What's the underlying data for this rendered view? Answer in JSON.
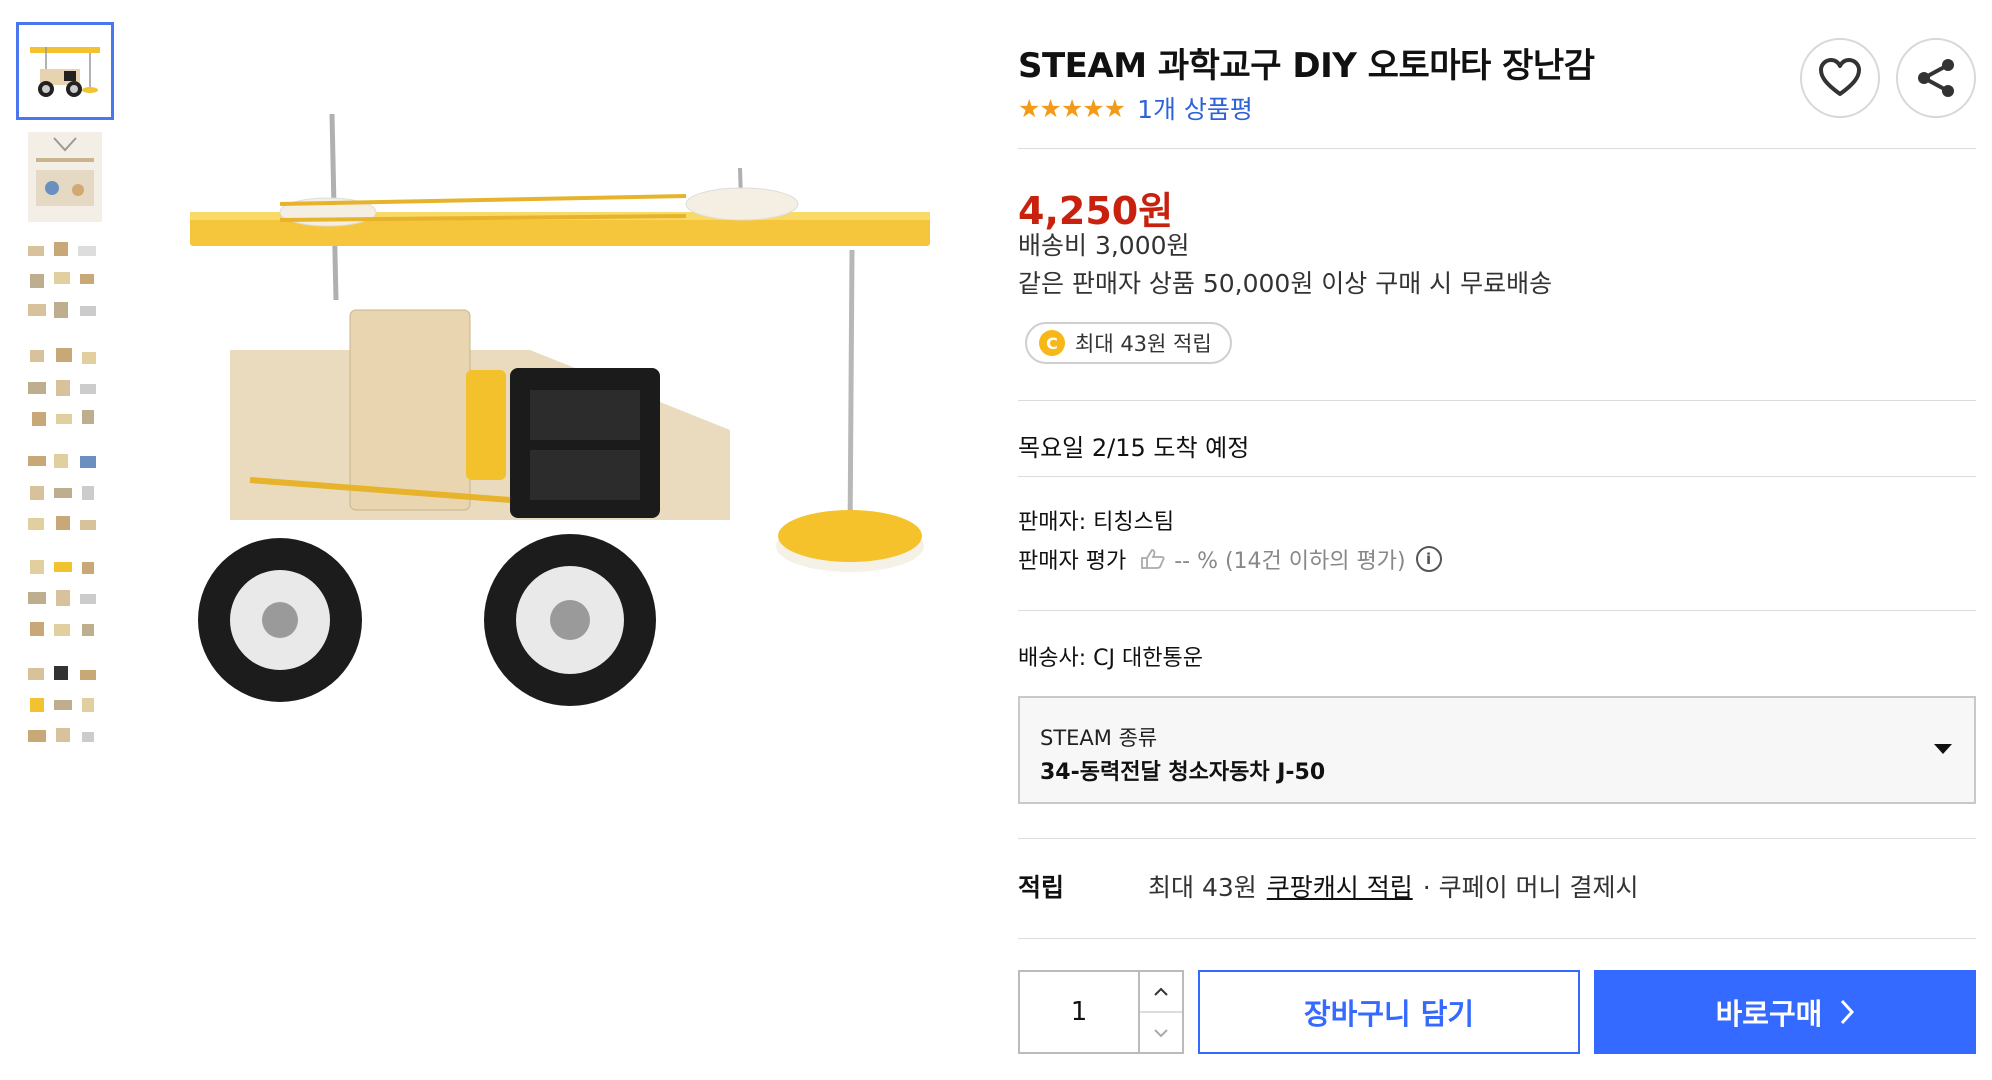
{
  "thumbnails": [
    {
      "name": "thumb-1"
    },
    {
      "name": "thumb-2"
    },
    {
      "name": "thumb-3"
    },
    {
      "name": "thumb-4"
    },
    {
      "name": "thumb-5"
    },
    {
      "name": "thumb-6"
    },
    {
      "name": "thumb-7"
    }
  ],
  "product": {
    "title": "STEAM 과학교구 DIY 오토마타 장난감",
    "stars": "★★★★★",
    "review_link": "1개 상품평",
    "price": "4,250원",
    "shipping_fee": "배송비 3,000원",
    "free_shipping_note": "같은 판매자 상품 50,000원 이상 구매 시 무료배송",
    "reward_coin": "C",
    "reward_pill": "최대 43원 적립",
    "delivery_date": "목요일 2/15 도착 예정",
    "seller": "판매자: 티칭스팀",
    "seller_rating_label": "판매자 평가",
    "seller_rating_value": "-- % (14건 이하의 평가)",
    "info_symbol": "i",
    "carrier": "배송사: CJ 대한통운"
  },
  "option": {
    "label": "STEAM 종류",
    "value": "34-동력전달 청소자동차 J-50"
  },
  "reward": {
    "label": "적립",
    "prefix": "최대 43원",
    "cash_link": "쿠팡캐시 적립",
    "suffix": "· 쿠페이 머니 결제시"
  },
  "purchase": {
    "quantity": "1",
    "cart_label": "장바구니 담기",
    "buy_label": "바로구매"
  },
  "colors": {
    "accent": "#346aff",
    "price": "#c8220f",
    "star": "#f39b18",
    "link": "#2f62d8"
  }
}
